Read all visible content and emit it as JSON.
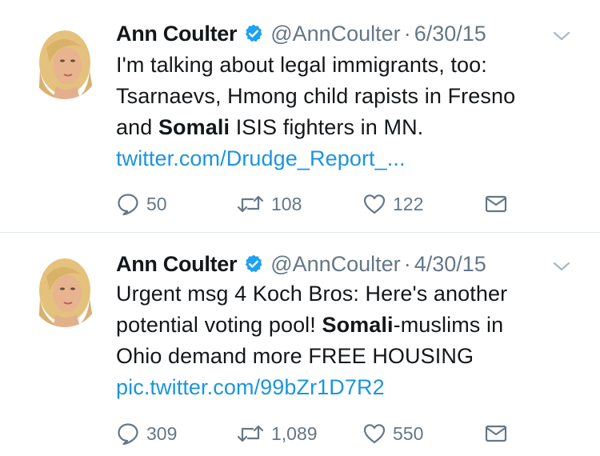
{
  "tweets": [
    {
      "name": "Ann Coulter",
      "handle": "@AnnCoulter",
      "separator": "·",
      "date": "6/30/15",
      "text_segments": [
        {
          "t": "I'm talking about legal immigrants, too:",
          "bold": false
        },
        {
          "t": "Tsarnaevs, Hmong child rapists in Fresno",
          "bold": false
        },
        {
          "t": "and ",
          "bold": false
        },
        {
          "t": "Somali",
          "bold": true
        },
        {
          "t": " ISIS fighters in MN.",
          "bold": false
        }
      ],
      "link": "twitter.com/Drudge_Report_...",
      "replies": "50",
      "retweets": "108",
      "likes": "122"
    },
    {
      "name": "Ann Coulter",
      "handle": "@AnnCoulter",
      "separator": "·",
      "date": "4/30/15",
      "text_segments": [
        {
          "t": "Urgent msg 4 Koch Bros: Here's another",
          "bold": false
        },
        {
          "t": "potential voting pool! ",
          "bold": false
        },
        {
          "t": "Somali",
          "bold": true
        },
        {
          "t": "-muslims in",
          "bold": false
        },
        {
          "t": "Ohio demand more FREE HOUSING",
          "bold": false
        }
      ],
      "link": "pic.twitter.com/99bZr1D7R2",
      "replies": "309",
      "retweets": "1,089",
      "likes": "550"
    }
  ],
  "colors": {
    "link": "#1b95e0",
    "meta": "#657786",
    "verified": "#1da1f2",
    "divider": "#e1e8ed"
  },
  "icons": {
    "verified": "verified-badge-icon",
    "more": "chevron-down-icon",
    "reply": "reply-icon",
    "retweet": "retweet-icon",
    "like": "heart-icon",
    "dm": "envelope-icon"
  }
}
